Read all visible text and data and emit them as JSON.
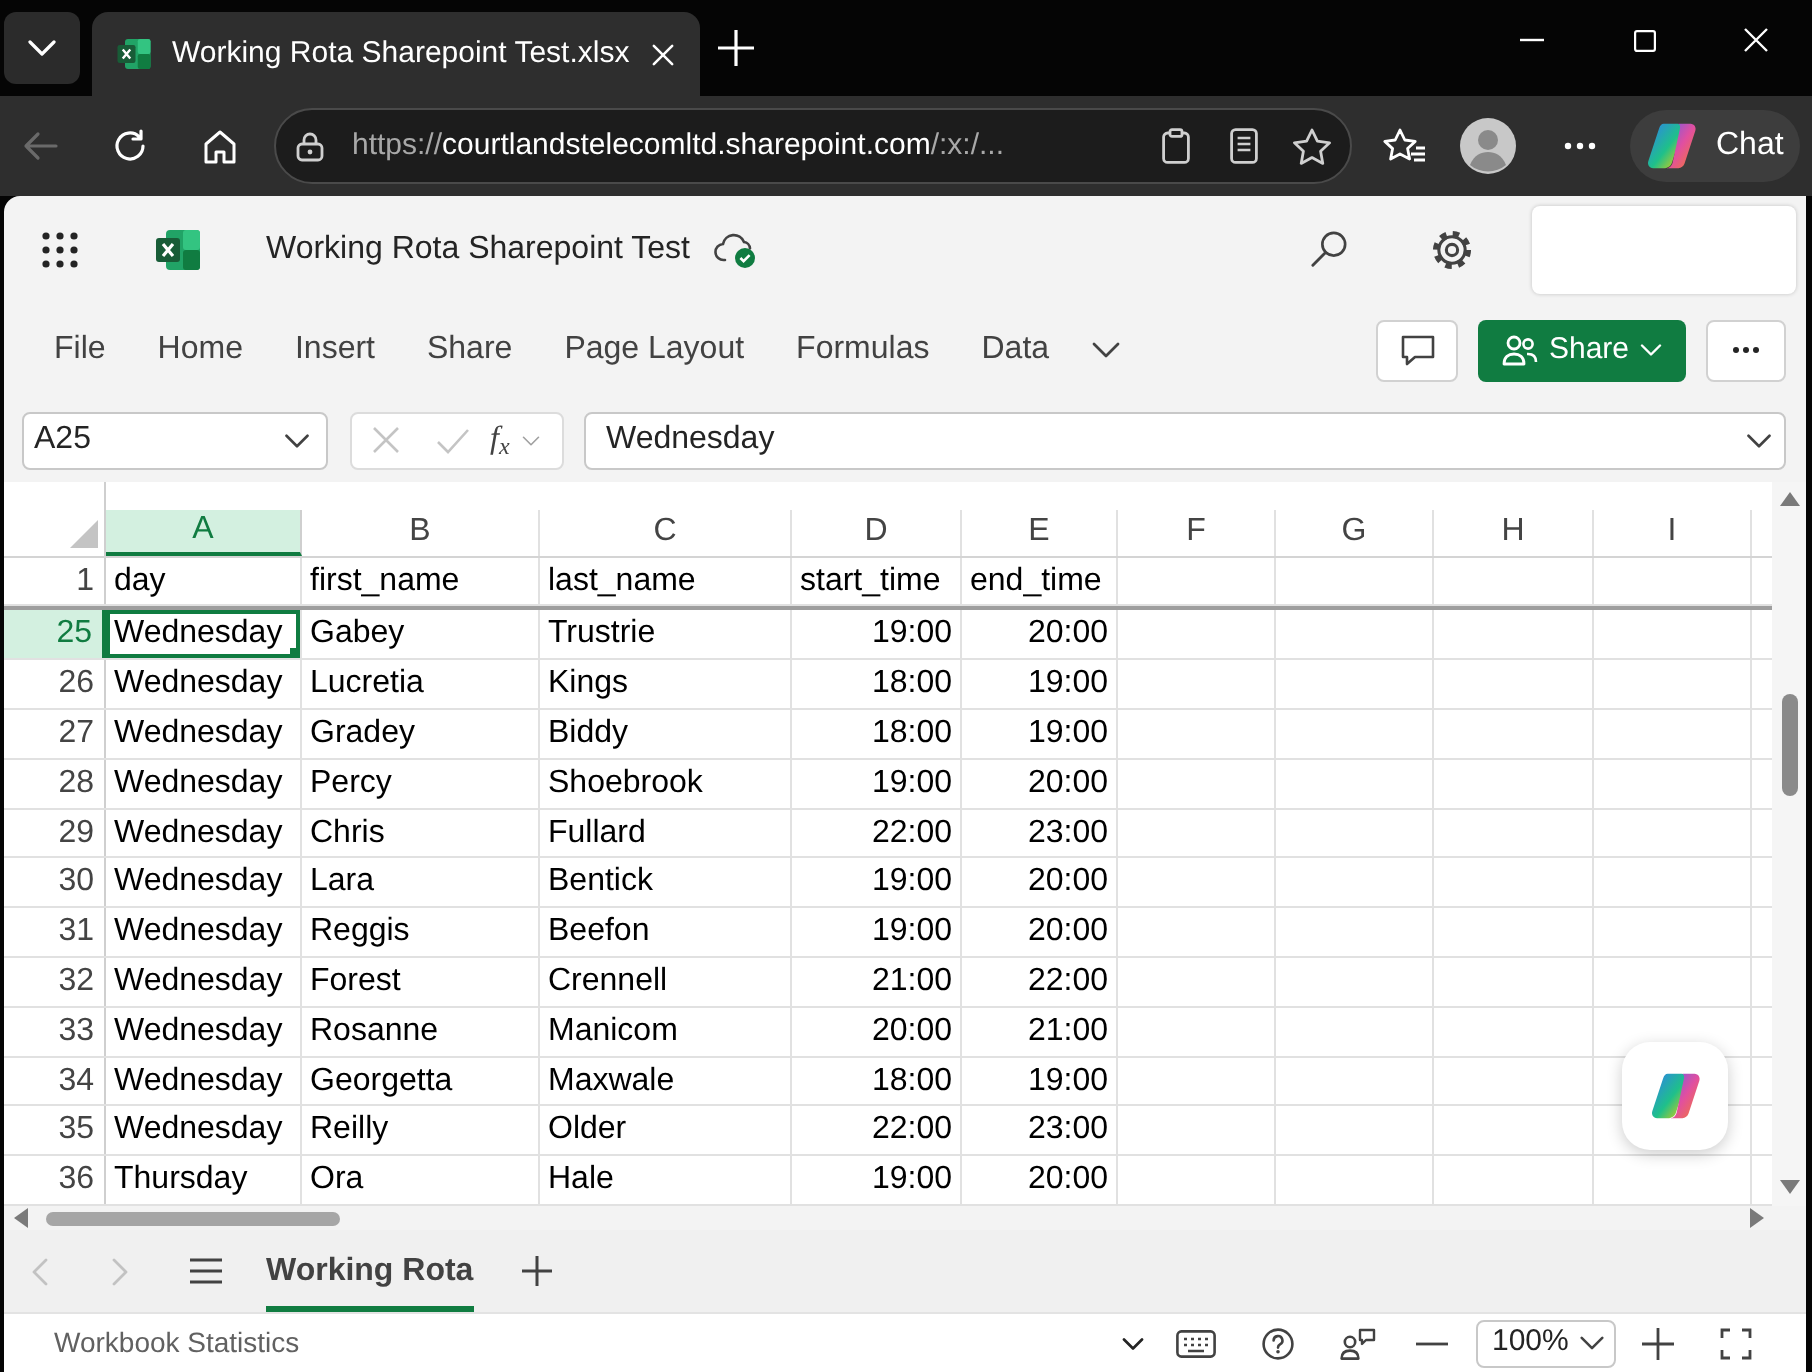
{
  "browser": {
    "tab": {
      "title": "Working Rota Sharepoint Test.xlsx"
    },
    "back_disabled": true,
    "address": {
      "scheme": "https://",
      "host": "courtlandstelecomltd.sharepoint.com",
      "path": "/:x:/..."
    },
    "chat_label": "Chat"
  },
  "app": {
    "document_title": "Working Rota Sharepoint Test",
    "saved": true
  },
  "ribbon": {
    "tabs": [
      {
        "label": "File",
        "selected": false
      },
      {
        "label": "Home",
        "selected": false
      },
      {
        "label": "Insert",
        "selected": false
      },
      {
        "label": "Share",
        "selected": false
      },
      {
        "label": "Page Layout",
        "selected": false
      },
      {
        "label": "Formulas",
        "selected": false
      },
      {
        "label": "Data",
        "selected": false
      }
    ],
    "share_label": "Share"
  },
  "formula_bar": {
    "name_box": "A25",
    "function_symbol": "f$_{x}$",
    "formula": "Wednesday"
  },
  "grid": {
    "columns": [
      {
        "letter": "A",
        "selected": true,
        "numeric": false
      },
      {
        "letter": "B",
        "selected": false,
        "numeric": false
      },
      {
        "letter": "C",
        "selected": false,
        "numeric": false
      },
      {
        "letter": "D",
        "selected": false,
        "numeric": true
      },
      {
        "letter": "E",
        "selected": false,
        "numeric": true
      },
      {
        "letter": "F",
        "selected": false
      },
      {
        "letter": "G",
        "selected": false
      },
      {
        "letter": "H",
        "selected": false
      },
      {
        "letter": "I",
        "selected": false
      }
    ],
    "rows": [
      {
        "number": "1",
        "kind": "header",
        "selected": false,
        "cells": [
          "day",
          "first_name",
          "last_name",
          "start_time",
          "end_time"
        ]
      },
      {
        "number": "25",
        "kind": "data",
        "selected": true,
        "cells": [
          "Wednesday",
          "Gabey",
          "Trustrie",
          "19:00",
          "20:00"
        ]
      },
      {
        "number": "26",
        "kind": "data",
        "selected": false,
        "cells": [
          "Wednesday",
          "Lucretia",
          "Kings",
          "18:00",
          "19:00"
        ]
      },
      {
        "number": "27",
        "kind": "data",
        "selected": false,
        "cells": [
          "Wednesday",
          "Gradey",
          "Biddy",
          "18:00",
          "19:00"
        ]
      },
      {
        "number": "28",
        "kind": "data",
        "selected": false,
        "cells": [
          "Wednesday",
          "Percy",
          "Shoebrook",
          "19:00",
          "20:00"
        ]
      },
      {
        "number": "29",
        "kind": "data",
        "selected": false,
        "cells": [
          "Wednesday",
          "Chris",
          "Fullard",
          "22:00",
          "23:00"
        ]
      },
      {
        "number": "30",
        "kind": "data",
        "selected": false,
        "cells": [
          "Wednesday",
          "Lara",
          "Bentick",
          "19:00",
          "20:00"
        ]
      },
      {
        "number": "31",
        "kind": "data",
        "selected": false,
        "cells": [
          "Wednesday",
          "Reggis",
          "Beefon",
          "19:00",
          "20:00"
        ]
      },
      {
        "number": "32",
        "kind": "data",
        "selected": false,
        "cells": [
          "Wednesday",
          "Forest",
          "Crennell",
          "21:00",
          "22:00"
        ]
      },
      {
        "number": "33",
        "kind": "data",
        "selected": false,
        "cells": [
          "Wednesday",
          "Rosanne",
          "Manicom",
          "20:00",
          "21:00"
        ]
      },
      {
        "number": "34",
        "kind": "data",
        "selected": false,
        "cells": [
          "Wednesday",
          "Georgetta",
          "Maxwale",
          "18:00",
          "19:00"
        ]
      },
      {
        "number": "35",
        "kind": "data",
        "selected": false,
        "cells": [
          "Wednesday",
          "Reilly",
          "Older",
          "22:00",
          "23:00"
        ]
      },
      {
        "number": "36",
        "kind": "data",
        "selected": false,
        "cells": [
          "Thursday",
          "Ora",
          "Hale",
          "19:00",
          "20:00"
        ]
      }
    ]
  },
  "sheet_nav": {
    "previous_disabled": true,
    "next_disabled": true
  },
  "sheet_tabs": [
    {
      "label": "Working Rota",
      "selected": true
    }
  ],
  "status_bar": {
    "label": "Workbook Statistics",
    "zoom": "100%"
  }
}
